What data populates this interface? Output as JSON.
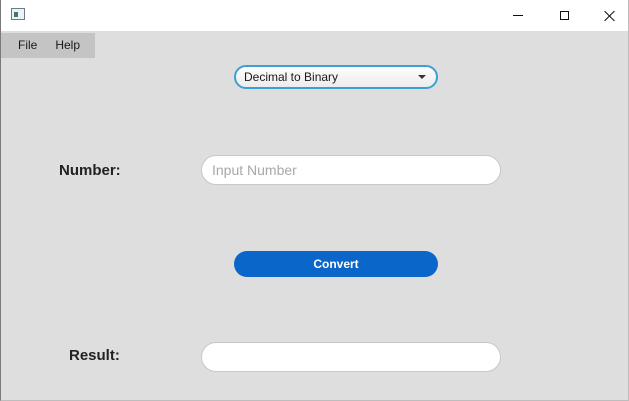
{
  "window": {
    "title": "",
    "icon": "app-window-icon"
  },
  "menu": {
    "items": [
      {
        "label": "File"
      },
      {
        "label": "Help"
      }
    ]
  },
  "converter": {
    "mode_selected": "Decimal to Binary"
  },
  "number_field": {
    "label": "Number:",
    "placeholder": "Input Number",
    "value": ""
  },
  "convert_button": {
    "label": "Convert"
  },
  "result_field": {
    "label": "Result:",
    "value": ""
  },
  "colors": {
    "accent": "#0a66c9",
    "focus_ring": "#3ba0d6",
    "background": "#dedede"
  }
}
